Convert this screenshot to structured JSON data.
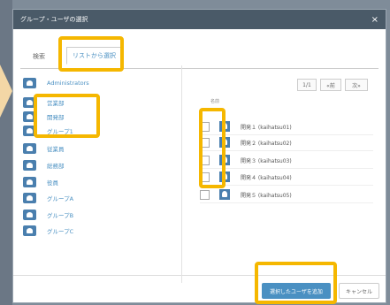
{
  "dialog": {
    "title": "グループ・ユーザの選択",
    "close_icon": "×"
  },
  "tabs": [
    {
      "label": "検索"
    },
    {
      "label": "リストから選択"
    }
  ],
  "groups": [
    {
      "label": "Administrators"
    },
    {
      "label": "営業部"
    },
    {
      "label": "開発部"
    },
    {
      "label": "グループ1"
    },
    {
      "label": "従業員"
    },
    {
      "label": "総務部"
    },
    {
      "label": "役員"
    },
    {
      "label": "グループA"
    },
    {
      "label": "グループB"
    },
    {
      "label": "グループC"
    }
  ],
  "pager": {
    "page": "1/1",
    "prev": "«前",
    "next": "次»"
  },
  "users_header": "名前",
  "users": [
    {
      "name": "開発１ (kaihatsu01)"
    },
    {
      "name": "開発２ (kaihatsu02)"
    },
    {
      "name": "開発３ (kaihatsu03)"
    },
    {
      "name": "開発４ (kaihatsu04)"
    },
    {
      "name": "開発５ (kaihatsu05)"
    }
  ],
  "footer": {
    "add_label": "選択したユーザを追加",
    "cancel_label": "キャンセル"
  }
}
